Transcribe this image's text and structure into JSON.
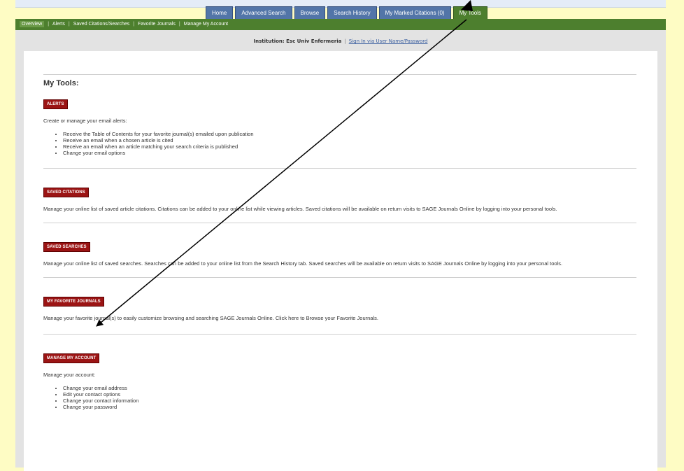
{
  "tabs": [
    "Home",
    "Advanced Search",
    "Browse",
    "Search History",
    "My Marked Citations (0)",
    "My Tools"
  ],
  "subnav": [
    "Overview",
    "Alerts",
    "Saved Citations/Searches",
    "Favorite Journals",
    "Manage My Account"
  ],
  "institution": {
    "label": "Institution:",
    "name": "Esc Univ Enfermeria",
    "sign_in": "Sign In via User Name/Password"
  },
  "page_title": "My Tools:",
  "alerts": {
    "badge": "ALERTS",
    "intro": "Create or manage your email alerts:",
    "items": [
      "Receive the Table of Contents for your favorite journal(s) emailed upon publication",
      "Receive an email when a chosen article is cited",
      "Receive an email when an article matching your search criteria is published",
      "Change your email options"
    ]
  },
  "saved_citations": {
    "badge": "SAVED CITATIONS",
    "text": "Manage your online list of saved article citations. Citations can be added to your online list while viewing articles. Saved citations will be available on return visits to SAGE Journals Online by logging into your personal tools."
  },
  "saved_searches": {
    "badge": "SAVED SEARCHES",
    "text": "Manage your online list of saved searches. Searches can be added to your online list from the Search History tab. Saved searches will be available on return visits to SAGE Journals Online by logging into your personal tools."
  },
  "favorite_journals": {
    "badge": "MY FAVORITE JOURNALS",
    "text": "Manage your favorite journal(s) to easily customize browsing and searching SAGE Journals Online. Click here to Browse your Favorite Journals."
  },
  "manage_account": {
    "badge": "MANAGE MY ACCOUNT",
    "intro": "Manage your account:",
    "items": [
      "Change your email address",
      "Edit your contact options",
      "Change your contact information",
      "Change your password"
    ]
  },
  "colors": {
    "tab_blue": "#5275a8",
    "nav_green": "#4d7f2e",
    "badge_red": "#9b1414",
    "page_bg": "#fefcc4"
  }
}
